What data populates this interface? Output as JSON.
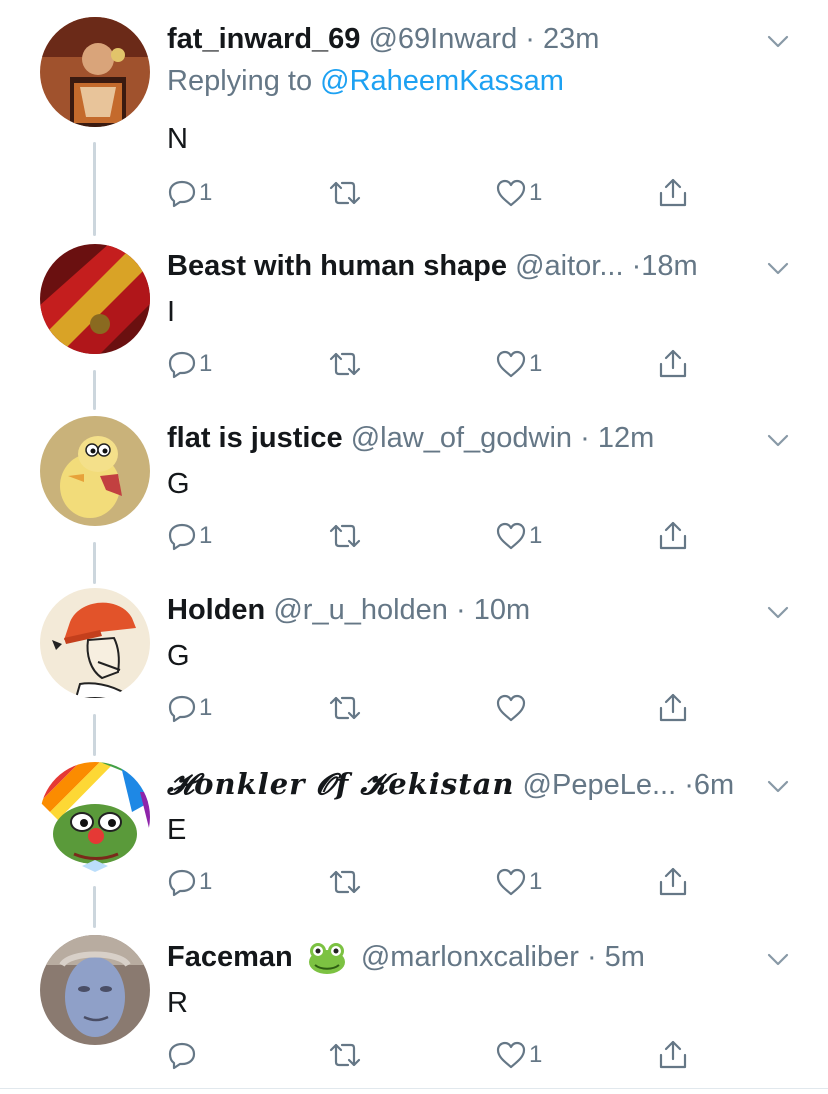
{
  "replying_label": "Replying to",
  "replying_mention": "@RaheemKassam",
  "tweets": [
    {
      "name": "fat_inward_69",
      "handle": "@69Inward",
      "dot": "·",
      "time": "23m",
      "text": "N",
      "replies": "1",
      "retweets": "",
      "likes": "1"
    },
    {
      "name": "Beast with human shape",
      "handle": "@aitor...",
      "dot": "·",
      "time": "18m",
      "text": "I",
      "replies": "1",
      "retweets": "",
      "likes": "1"
    },
    {
      "name": "flat is justice",
      "handle": "@law_of_godwin",
      "dot": "·",
      "time": "12m",
      "text": "G",
      "replies": "1",
      "retweets": "",
      "likes": "1"
    },
    {
      "name": "Holden",
      "handle": "@r_u_holden",
      "dot": "·",
      "time": "10m",
      "text": "G",
      "replies": "1",
      "retweets": "",
      "likes": ""
    },
    {
      "name": "𝓗onkler 𝓞f 𝓚ekistan",
      "handle": "@PepeLe...",
      "dot": "·",
      "time": "6m",
      "text": "E",
      "replies": "1",
      "retweets": "",
      "likes": "1"
    },
    {
      "name": "Faceman",
      "emoji": "frog-emoji",
      "handle": "@marlonxcaliber",
      "dot": "·",
      "time": "5m",
      "text": "R",
      "replies": "",
      "retweets": "",
      "likes": "1"
    }
  ],
  "colors": {
    "text": "#14171a",
    "secondary": "#657786",
    "link": "#1da1f2",
    "thread_line": "#ccd6dd"
  }
}
